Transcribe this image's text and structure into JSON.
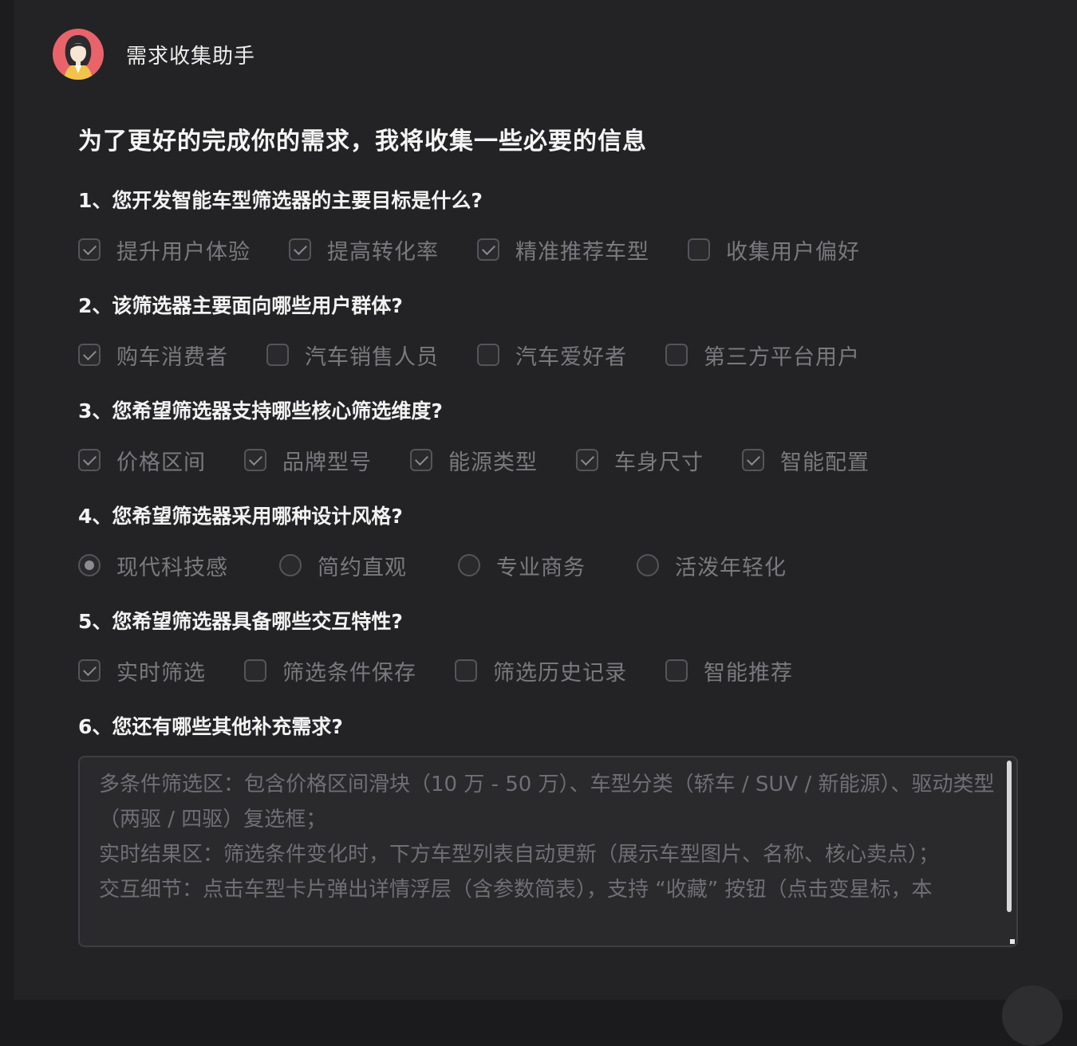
{
  "assistant": {
    "name": "需求收集助手",
    "avatar_icon": "female-assistant-avatar-icon"
  },
  "intro": "为了更好的完成你的需求，我将收集一些必要的信息",
  "questions": [
    {
      "title": "1、您开发智能车型筛选器的主要目标是什么?",
      "type": "checkbox",
      "options": [
        {
          "label": "提升用户体验",
          "checked": true
        },
        {
          "label": "提高转化率",
          "checked": true
        },
        {
          "label": "精准推荐车型",
          "checked": true
        },
        {
          "label": "收集用户偏好",
          "checked": false
        }
      ]
    },
    {
      "title": "2、该筛选器主要面向哪些用户群体?",
      "type": "checkbox",
      "options": [
        {
          "label": "购车消费者",
          "checked": true
        },
        {
          "label": "汽车销售人员",
          "checked": false
        },
        {
          "label": "汽车爱好者",
          "checked": false
        },
        {
          "label": "第三方平台用户",
          "checked": false
        }
      ]
    },
    {
      "title": "3、您希望筛选器支持哪些核心筛选维度?",
      "type": "checkbox",
      "options": [
        {
          "label": "价格区间",
          "checked": true
        },
        {
          "label": "品牌型号",
          "checked": true
        },
        {
          "label": "能源类型",
          "checked": true
        },
        {
          "label": "车身尺寸",
          "checked": true
        },
        {
          "label": "智能配置",
          "checked": true
        }
      ]
    },
    {
      "title": "4、您希望筛选器采用哪种设计风格?",
      "type": "radio",
      "options": [
        {
          "label": "现代科技感",
          "checked": true
        },
        {
          "label": "简约直观",
          "checked": false
        },
        {
          "label": "专业商务",
          "checked": false
        },
        {
          "label": "活泼年轻化",
          "checked": false
        }
      ]
    },
    {
      "title": "5、您希望筛选器具备哪些交互特性?",
      "type": "checkbox",
      "options": [
        {
          "label": "实时筛选",
          "checked": true
        },
        {
          "label": "筛选条件保存",
          "checked": false
        },
        {
          "label": "筛选历史记录",
          "checked": false
        },
        {
          "label": "智能推荐",
          "checked": false
        }
      ]
    }
  ],
  "extra": {
    "title": "6、您还有哪些其他补充需求?",
    "value": "多条件筛选区：包含价格区间滑块（10 万 - 50 万）、车型分类（轿车 / SUV / 新能源）、驱动类型（两驱 / 四驱）复选框；\n实时结果区：筛选条件变化时，下方车型列表自动更新（展示车型图片、名称、核心卖点）；\n交互细节：点击车型卡片弹出详情浮层（含参数简表），支持 “收藏” 按钮（点击变星标，本"
  },
  "colors": {
    "background": "#232325",
    "title_text": "#f2f2f2",
    "option_text": "#7a7a7e",
    "avatar_bg": "#e9636b"
  }
}
